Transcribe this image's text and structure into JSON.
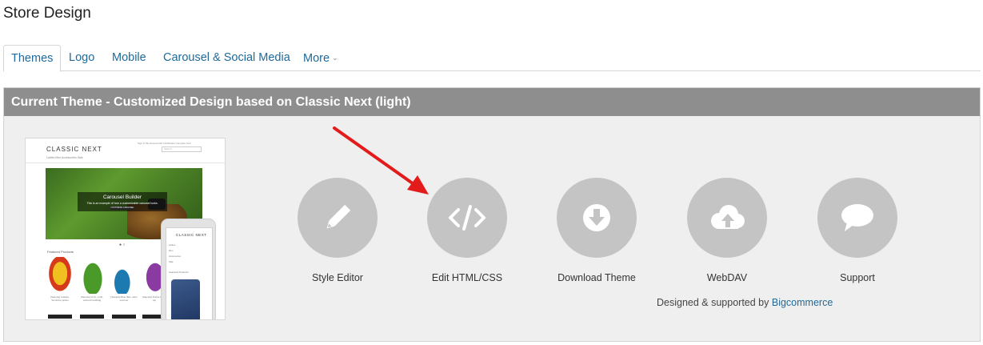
{
  "page": {
    "title": "Store Design"
  },
  "tabs": [
    {
      "label": "Themes",
      "active": true
    },
    {
      "label": "Logo"
    },
    {
      "label": "Mobile"
    },
    {
      "label": "Carousel & Social Media"
    },
    {
      "label": "More"
    }
  ],
  "panel": {
    "header": "Current Theme - Customized Design based on Classic Next (light)"
  },
  "preview": {
    "logo": "CLASSIC NEXT",
    "nav": "Ladies   Men   Accessories   Sale",
    "topnav": "Sign in   My Account   Gift Certificates   Compare   Cart",
    "search": "Search",
    "carousel_title": "Carousel Builder",
    "carousel_sub": "This is an example of how a customizable carousel looks.",
    "carousel_btn": "CUSTOMIZE CAROUSEL",
    "dots": "● ○",
    "featured": "Featured Products",
    "products": [
      "[Sample] Collette, Sunshine jacket",
      "[Sample] Ionic, multi-colored handbag",
      "[Sample] Blue flats, satin summer",
      "[Sample] Purple Ruffle top"
    ],
    "phone_logo": "CLASSIC NEXT",
    "phone_menu": [
      "Ladies",
      "Men",
      "Accessories",
      "Sale"
    ],
    "phone_featured": "Featured Products"
  },
  "actions": [
    {
      "label": "Style Editor",
      "icon": "pencil-icon"
    },
    {
      "label": "Edit HTML/CSS",
      "icon": "code-icon"
    },
    {
      "label": "Download Theme",
      "icon": "download-icon"
    },
    {
      "label": "WebDAV",
      "icon": "cloud-upload-icon"
    },
    {
      "label": "Support",
      "icon": "speech-bubble-icon"
    }
  ],
  "credit": {
    "text": "Designed & supported by",
    "link": "Bigcommerce"
  },
  "colors": {
    "link": "#1f6a9a",
    "header_bg": "#8e8e8e",
    "circle": "#c4c4c4",
    "arrow": "#e31b1b"
  }
}
